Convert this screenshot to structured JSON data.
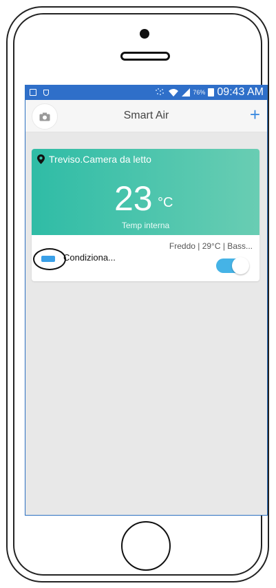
{
  "statusbar": {
    "battery": "76%",
    "time": "09:43 AM"
  },
  "app": {
    "title": "Smart Air",
    "add_symbol": "+"
  },
  "card": {
    "location": "Treviso.Camera da letto",
    "temp_value": "23",
    "temp_unit": "°C",
    "temp_label": "Temp interna",
    "mode": "Freddo | 29°C | Bass...",
    "device_name": "Condiziona...",
    "power_on": true
  },
  "colors": {
    "statusbar": "#2f6fc9",
    "card_gradient_start": "#2fbca6",
    "card_gradient_end": "#69cdb3",
    "accent": "#3d8be0",
    "toggle_on": "#45b3e6"
  },
  "icons": [
    "camera-icon",
    "plus-icon",
    "location-pin-icon",
    "air-conditioner-icon",
    "wifi-icon",
    "signal-icon",
    "battery-icon"
  ]
}
